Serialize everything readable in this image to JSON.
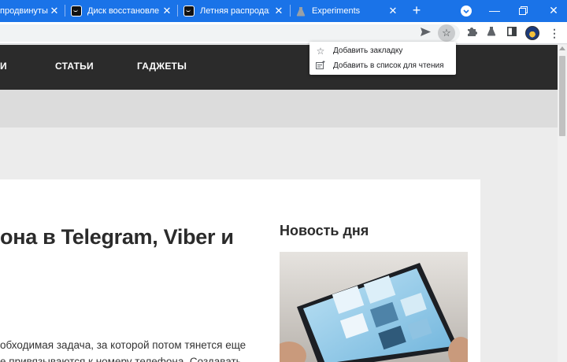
{
  "tabs": [
    {
      "title": "продвинуты",
      "favicon": "dark-box-favicon"
    },
    {
      "title": "Диск восстановле",
      "favicon": "box-smile-favicon"
    },
    {
      "title": "Летняя распродажа",
      "favicon": "box-smile-favicon"
    },
    {
      "title": "Experiments",
      "favicon": "flask-favicon"
    }
  ],
  "toolbar": {
    "icons": [
      "send-tab-icon",
      "bookmark-star-icon",
      "extensions-icon",
      "labs-flask-icon",
      "side-panel-icon",
      "profile-avatar",
      "menu-dots-icon"
    ]
  },
  "bookmark_menu": {
    "items": [
      {
        "label": "Добавить закладку",
        "icon": "star-outline-icon"
      },
      {
        "label": "Добавить в список для чтения",
        "icon": "reading-list-icon"
      }
    ]
  },
  "site_nav": {
    "items": [
      "И",
      "СТАТЬИ",
      "ГАДЖЕТЫ"
    ]
  },
  "article": {
    "headline": "она в Telegram, Viber и",
    "body_lines": [
      "обходимая задача, за которой потом тянется еще",
      "е привязываются к номеру телефона. Создавать"
    ]
  },
  "sidebar": {
    "title": "Новость дня",
    "image_alt": "tablet-with-widgets-photo"
  },
  "colors": {
    "chrome_accent": "#1a73e8",
    "site_nav_bg": "#2b2b2b"
  }
}
